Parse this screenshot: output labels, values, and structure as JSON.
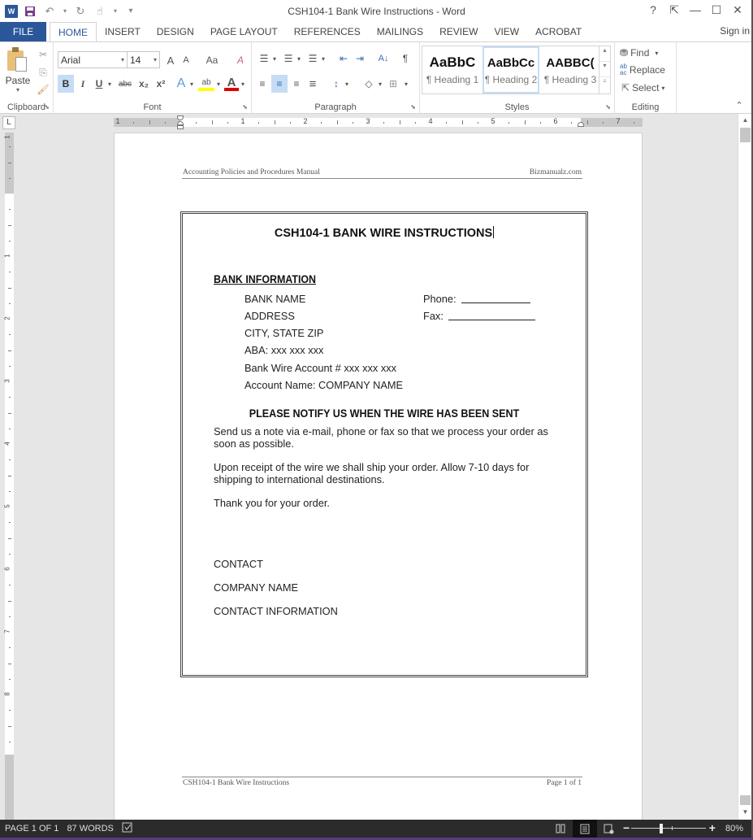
{
  "window": {
    "title": "CSH104-1 Bank Wire Instructions - Word",
    "controls": {
      "help": "?",
      "ribbon_display": "⇱",
      "minimize": "—",
      "maximize": "☐",
      "close": "✕"
    }
  },
  "quick_access": {
    "app_icon": "W",
    "save_icon": "💾",
    "undo_icon": "↶",
    "redo_icon": "↻",
    "touch_icon": "☝",
    "customize_icon": "▾"
  },
  "tabs": [
    {
      "label": "FILE"
    },
    {
      "label": "HOME",
      "active": true
    },
    {
      "label": "INSERT"
    },
    {
      "label": "DESIGN"
    },
    {
      "label": "PAGE LAYOUT"
    },
    {
      "label": "REFERENCES"
    },
    {
      "label": "MAILINGS"
    },
    {
      "label": "REVIEW"
    },
    {
      "label": "VIEW"
    },
    {
      "label": "ACROBAT"
    }
  ],
  "sign_in": "Sign in",
  "ribbon": {
    "clipboard": {
      "label": "Clipboard",
      "paste": "Paste",
      "cut_icon": "✂",
      "copy_icon": "⎘",
      "format_painter_icon": "🖌"
    },
    "font": {
      "label": "Font",
      "font_name": "Arial",
      "font_size": "14",
      "grow": "A",
      "shrink": "A",
      "change_case": "Aa",
      "clear_format": "A",
      "bold": "B",
      "italic": "I",
      "underline": "U",
      "strikethrough": "abc",
      "subscript": "x₂",
      "superscript": "x²",
      "text_effects": "A",
      "highlight": "ab",
      "font_color": "A"
    },
    "paragraph": {
      "label": "Paragraph",
      "bullets": "☰",
      "numbering": "☰",
      "multilevel": "☰",
      "decrease_indent": "⇤",
      "increase_indent": "⇥",
      "sort": "A↓",
      "show_marks": "¶",
      "align_left": "≡",
      "align_center": "≡",
      "align_right": "≡",
      "justify": "≡",
      "line_spacing": "↕",
      "shading": "◇",
      "borders": "⊞"
    },
    "styles": {
      "label": "Styles",
      "items": [
        {
          "sample": "AaBbC",
          "name": "¶ Heading 1"
        },
        {
          "sample": "AaBbCc",
          "name": "¶ Heading 2",
          "selected": true
        },
        {
          "sample": "AABBC(",
          "name": "¶ Heading 3"
        }
      ]
    },
    "editing": {
      "label": "Editing",
      "find": "Find",
      "replace": "Replace",
      "select": "Select"
    }
  },
  "ruler": {
    "tab_selector": "L",
    "numbers": [
      "1",
      "1",
      "2",
      "3",
      "4",
      "5",
      "6",
      "7"
    ],
    "vnumbers": [
      "1",
      "1",
      "2",
      "3",
      "4",
      "5",
      "6",
      "7",
      "8"
    ]
  },
  "document": {
    "header_left": "Accounting Policies and Procedures Manual",
    "header_right": "Bizmanualz.com",
    "title": "CSH104-1 BANK WIRE INSTRUCTIONS",
    "bank_info_heading": "BANK INFORMATION",
    "bank_lines": [
      "BANK NAME",
      "ADDRESS",
      "CITY, STATE ZIP",
      "ABA: xxx xxx xxx",
      "Bank Wire Account # xxx xxx xxx",
      "Account Name: COMPANY NAME"
    ],
    "phone_label": "Phone:",
    "fax_label": "Fax:",
    "notify_heading": "PLEASE NOTIFY US WHEN THE WIRE HAS BEEN SENT",
    "paragraphs": [
      "Send us a note via e-mail, phone or fax so that we process your order as soon as possible.",
      "Upon receipt of the wire we shall ship your order.  Allow 7-10 days for shipping to international destinations.",
      "Thank you for your order."
    ],
    "contact_lines": [
      "CONTACT",
      "COMPANY NAME",
      "CONTACT INFORMATION"
    ],
    "footer_left": "CSH104-1 Bank Wire Instructions",
    "footer_right": "Page 1 of 1"
  },
  "status": {
    "page": "PAGE 1 OF 1",
    "words": "87 WORDS",
    "proofing_icon": "📖",
    "read_mode_icon": "📖",
    "print_layout_icon": "▤",
    "web_layout_icon": "🗔",
    "zoom_minus": "−",
    "zoom_plus": "+",
    "zoom": "80%",
    "zoom_fraction": 0.4
  },
  "colors": {
    "accent": "#2b579a",
    "status_bar": "#2b2b2b",
    "selected_button": "#c5dcf4",
    "highlight_yellow": "#ffff00",
    "font_color_red": "#e00000"
  }
}
